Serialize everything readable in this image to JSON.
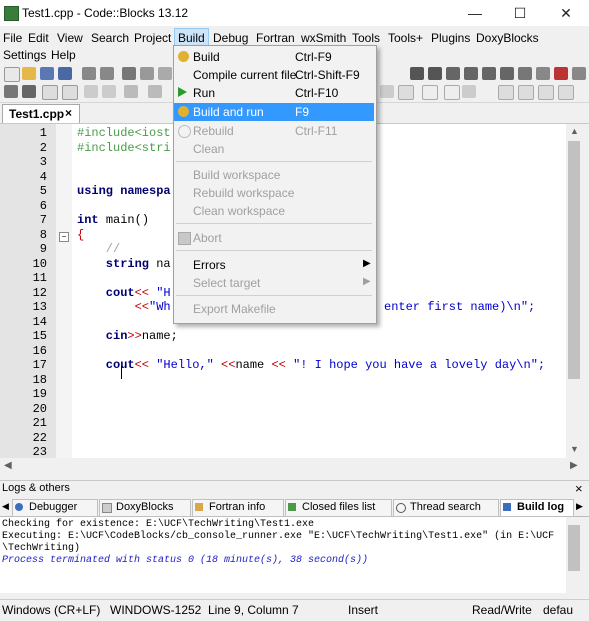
{
  "window": {
    "title": "Test1.cpp - Code::Blocks 13.12",
    "minimize": "—",
    "maximize": "☐",
    "close": "✕"
  },
  "menubar": {
    "row1": [
      "File",
      "Edit",
      "View",
      "Search",
      "Project",
      "Build",
      "Debug",
      "Fortran",
      "wxSmith",
      "Tools",
      "Tools+",
      "Plugins",
      "DoxyBlocks"
    ],
    "row2": [
      "Settings",
      "Help"
    ],
    "active": "Build"
  },
  "editor": {
    "tab_label": "Test1.cpp",
    "tab_close": "×",
    "line_numbers": [
      "1",
      "2",
      "3",
      "4",
      "5",
      "6",
      "7",
      "8",
      "9",
      "10",
      "11",
      "12",
      "13",
      "14",
      "15",
      "16",
      "17",
      "18",
      "19",
      "20",
      "21",
      "22",
      "23"
    ],
    "lines": {
      "l1": "#include<iost",
      "l2": "#include<stri",
      "l5a": "using ",
      "l5b": "namespa",
      "l7a": "int ",
      "l7b": "main()",
      "l8": "{",
      "l9": "    //",
      "l10a": "    string ",
      "l10b": "na",
      "l12a": "    cout",
      "l12b": "<< ",
      "l12c": "\"H",
      "l13a": "        <<",
      "l13b": "\"Wh",
      "l13c": "enter first name)\\n\";",
      "l15a": "    cin",
      "l15b": ">>",
      "l15c": "name;",
      "l17a": "    cout",
      "l17b": "<< ",
      "l17c": "\"Hello,\"",
      "l17d": " <<",
      "l17e": "name ",
      "l17f": "<< ",
      "l17g": "\"! I hope you have a lovely day\\n\";"
    }
  },
  "build_menu": {
    "items": [
      {
        "label": "Build",
        "shortcut": "Ctrl-F9",
        "enabled": true
      },
      {
        "label": "Compile current file",
        "shortcut": "Ctrl-Shift-F9",
        "enabled": true
      },
      {
        "label": "Run",
        "shortcut": "Ctrl-F10",
        "enabled": true
      },
      {
        "label": "Build and run",
        "shortcut": "F9",
        "enabled": true,
        "highlighted": true
      },
      {
        "label": "Rebuild",
        "shortcut": "Ctrl-F11",
        "enabled": false
      },
      {
        "label": "Clean",
        "shortcut": "",
        "enabled": false
      },
      {
        "label": "Build workspace",
        "shortcut": "",
        "enabled": false
      },
      {
        "label": "Rebuild workspace",
        "shortcut": "",
        "enabled": false
      },
      {
        "label": "Clean workspace",
        "shortcut": "",
        "enabled": false
      },
      {
        "label": "Abort",
        "shortcut": "",
        "enabled": false
      },
      {
        "label": "Errors",
        "shortcut": "",
        "enabled": true
      },
      {
        "label": "Select target",
        "shortcut": "",
        "enabled": false
      },
      {
        "label": "Export Makefile",
        "shortcut": "",
        "enabled": false
      }
    ]
  },
  "logs": {
    "title": "Logs & others",
    "close": "×",
    "tabs": [
      "Debugger",
      "DoxyBlocks",
      "Fortran info",
      "Closed files list",
      "Thread search",
      "Build log"
    ],
    "active_tab": "Build log",
    "lines": [
      "Checking for existence: E:\\UCF\\TechWriting\\Test1.exe",
      "Executing: E:\\UCF\\CodeBlocks/cb_console_runner.exe \"E:\\UCF\\TechWriting\\Test1.exe\" (in E:\\UCF",
      "\\TechWriting)",
      "Process terminated with status 0 (18 minute(s), 38 second(s))"
    ]
  },
  "status": {
    "line_endings": "Windows (CR+LF)",
    "encoding": "WINDOWS-1252",
    "position": "Line 9, Column 7",
    "mode": "Insert",
    "access": "Read/Write",
    "lang": "defau"
  },
  "colors": {
    "highlight": "#3399ff",
    "preprocessor": "#4b9b4b",
    "keyword": "#00006e",
    "string": "#0000cc",
    "operator": "#c00000"
  }
}
